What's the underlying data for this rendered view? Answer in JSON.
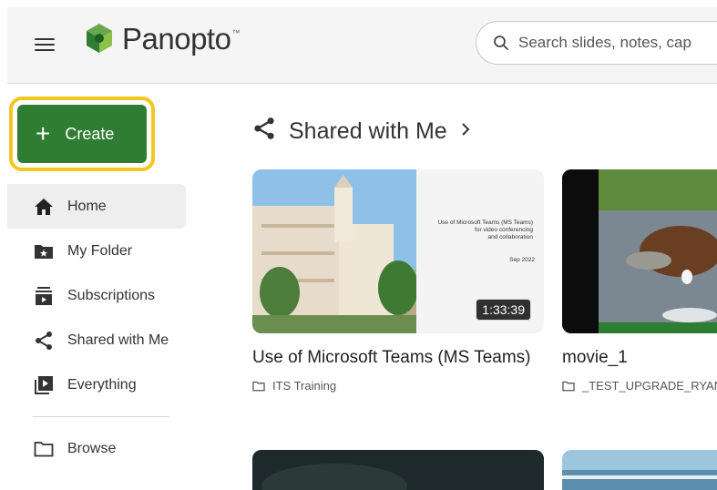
{
  "header": {
    "logo_text": "Panopto",
    "logo_tm": "™",
    "search_placeholder": "Search slides, notes, cap"
  },
  "create": {
    "label": "Create"
  },
  "sidebar": {
    "items": [
      {
        "label": "Home",
        "icon": "home-icon",
        "active": true
      },
      {
        "label": "My Folder",
        "icon": "folder-star-icon"
      },
      {
        "label": "Subscriptions",
        "icon": "subscriptions-icon"
      },
      {
        "label": "Shared with Me",
        "icon": "share-icon"
      },
      {
        "label": "Everything",
        "icon": "library-play-icon"
      }
    ],
    "browse": {
      "label": "Browse",
      "icon": "folder-icon"
    }
  },
  "section": {
    "title": "Shared with Me"
  },
  "cards": [
    {
      "title": "Use of Microsoft Teams (MS Teams)",
      "folder": "ITS Training",
      "duration": "1:33:39",
      "slide_lines": [
        "Use of Microsoft Teams (MS Teams)",
        "for video conferencing",
        "and collaboration"
      ],
      "slide_date": "Sep 2022"
    },
    {
      "title": "movie_1",
      "folder": "_TEST_UPGRADE_RYAN"
    }
  ],
  "colors": {
    "create_green": "#2e7d32",
    "highlight_yellow": "#f3c620"
  }
}
